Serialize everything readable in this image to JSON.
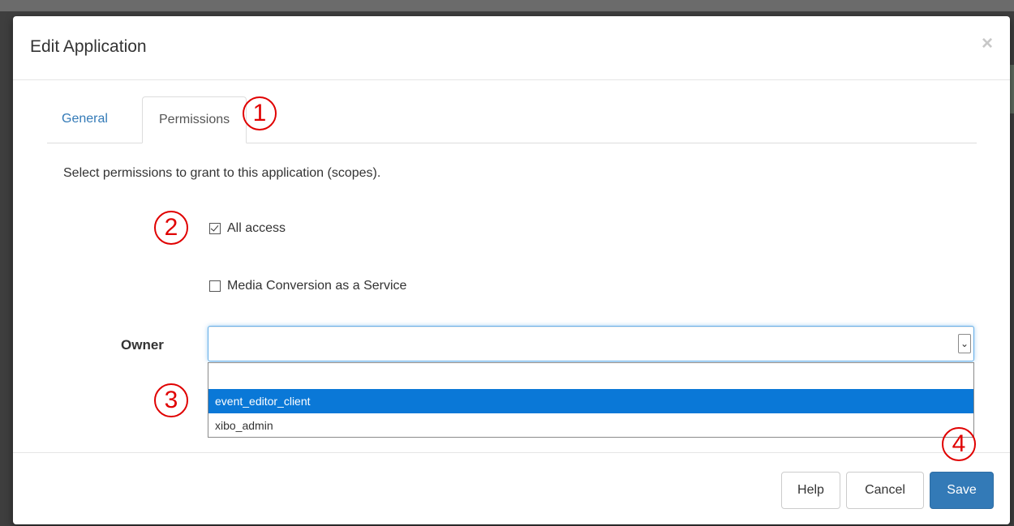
{
  "modal": {
    "title": "Edit Application",
    "close_glyph": "×"
  },
  "tabs": [
    {
      "label": "General",
      "active": false
    },
    {
      "label": "Permissions",
      "active": true
    }
  ],
  "permissions": {
    "description": "Select permissions to grant to this application (scopes).",
    "scopes": [
      {
        "label": "All access",
        "checked": true
      },
      {
        "label": "Media Conversion as a Service",
        "checked": false
      }
    ]
  },
  "owner": {
    "label": "Owner",
    "value": "",
    "options": [
      "",
      "event_editor_client",
      "xibo_admin"
    ],
    "highlighted": "event_editor_client"
  },
  "annotations": [
    "1",
    "2",
    "3",
    "4"
  ],
  "footer": {
    "help_label": "Help",
    "cancel_label": "Cancel",
    "save_label": "Save"
  },
  "colors": {
    "primary": "#337ab7",
    "highlight": "#0a78d7",
    "annotation": "#e00000"
  }
}
